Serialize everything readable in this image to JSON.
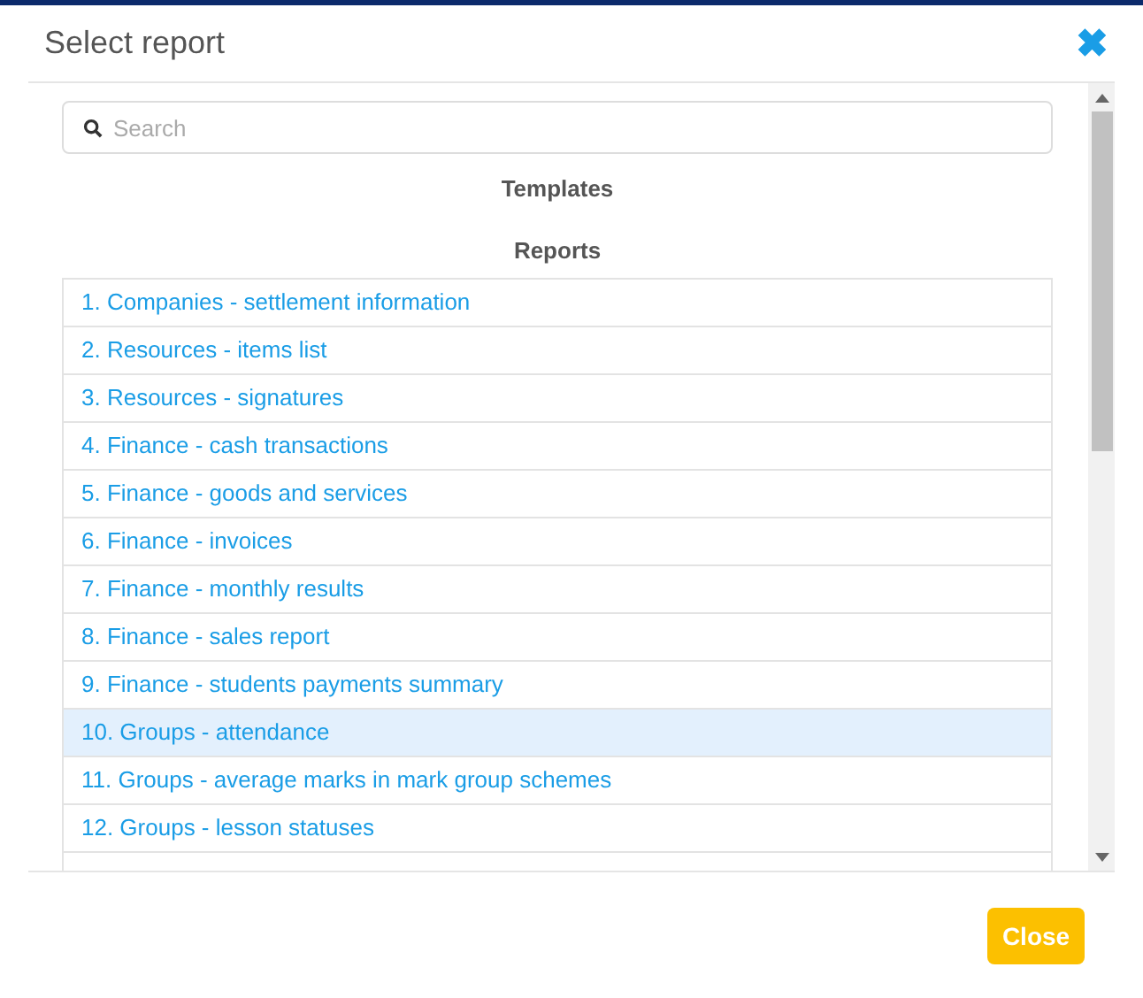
{
  "dialog": {
    "title": "Select report",
    "close_icon": "✖"
  },
  "search": {
    "placeholder": "Search"
  },
  "sections": [
    {
      "title": "Templates"
    },
    {
      "title": "Reports"
    }
  ],
  "reports": [
    {
      "label": "1. Companies - settlement information",
      "selected": false
    },
    {
      "label": "2. Resources - items list",
      "selected": false
    },
    {
      "label": "3. Resources - signatures",
      "selected": false
    },
    {
      "label": "4. Finance - cash transactions",
      "selected": false
    },
    {
      "label": "5. Finance - goods and services",
      "selected": false
    },
    {
      "label": "6. Finance - invoices",
      "selected": false
    },
    {
      "label": "7. Finance - monthly results",
      "selected": false
    },
    {
      "label": "8. Finance - sales report",
      "selected": false
    },
    {
      "label": "9. Finance - students payments summary",
      "selected": false
    },
    {
      "label": "10. Groups - attendance",
      "selected": true
    },
    {
      "label": "11. Groups - average marks in mark group schemes",
      "selected": false
    },
    {
      "label": "12. Groups - lesson statuses",
      "selected": false
    }
  ],
  "footer": {
    "close_button": "Close"
  }
}
